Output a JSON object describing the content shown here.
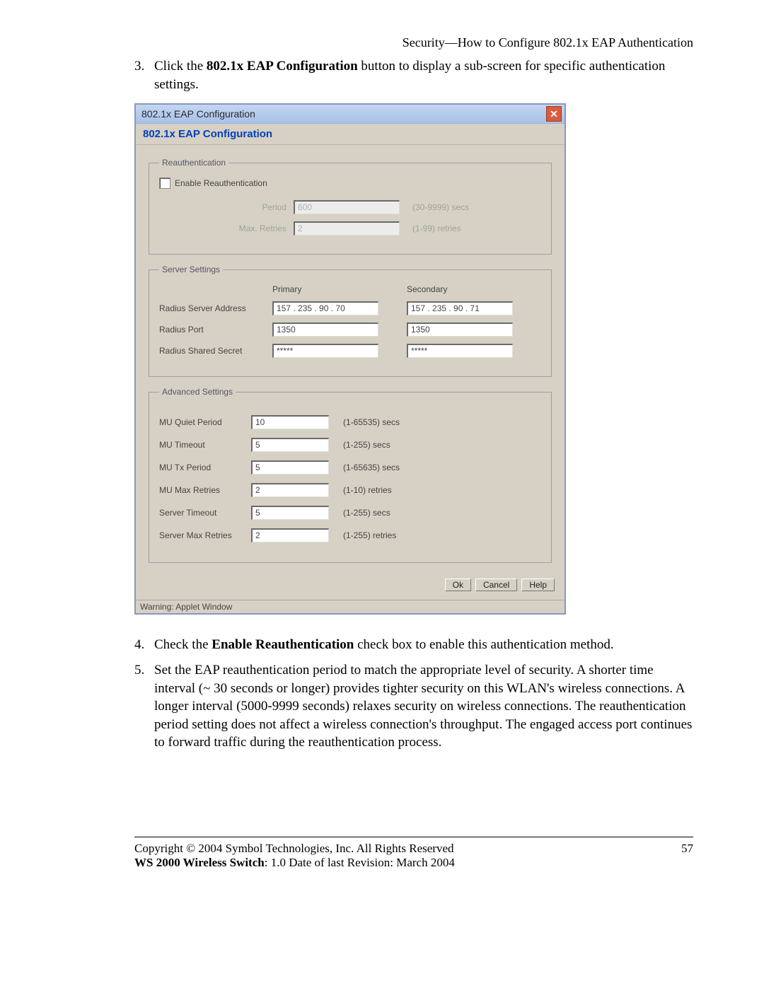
{
  "header": "Security—How to Configure 802.1x EAP Authentication",
  "steps": {
    "s3_num": "3.",
    "s3_a": "Click the ",
    "s3_bold": "802.1x EAP Configuration",
    "s3_b": " button to display a sub-screen for specific authentication settings.",
    "s4_num": "4.",
    "s4_a": "Check the ",
    "s4_bold": "Enable Reauthentication",
    "s4_b": " check box to enable this authentication method.",
    "s5_num": "5.",
    "s5": "Set the EAP reauthentication period to match the appropriate level of security. A shorter time interval (~ 30 seconds or longer) provides tighter security on this WLAN's wireless connections. A longer interval (5000-9999 seconds) relaxes security on wireless connections. The reauthentication period setting does not affect a wireless connection's throughput. The engaged access port continues to forward traffic during the reauthentication process."
  },
  "dialog": {
    "title": "802.1x EAP Configuration",
    "panel_title": "802.1x EAP Configuration",
    "close_glyph": "✕",
    "reauth": {
      "legend": "Reauthentication",
      "enable_label": "Enable Reauthentication",
      "period_label": "Period",
      "period_value": "600",
      "period_hint": "(30-9999) secs",
      "retries_label": "Max. Retries",
      "retries_value": "2",
      "retries_hint": "(1-99) retries"
    },
    "server": {
      "legend": "Server Settings",
      "primary_head": "Primary",
      "secondary_head": "Secondary",
      "addr_label": "Radius Server Address",
      "addr_primary": "157 . 235 . 90   . 70",
      "addr_secondary": "157 . 235 . 90   . 71",
      "port_label": "Radius Port",
      "port_primary": "1350",
      "port_secondary": "1350",
      "secret_label": "Radius Shared Secret",
      "secret_primary": "*****",
      "secret_secondary": "*****"
    },
    "advanced": {
      "legend": "Advanced Settings",
      "rows": [
        {
          "label": "MU Quiet Period",
          "value": "10",
          "hint": "(1-65535) secs"
        },
        {
          "label": "MU Timeout",
          "value": "5",
          "hint": "(1-255) secs"
        },
        {
          "label": "MU Tx Period",
          "value": "5",
          "hint": "(1-65635) secs"
        },
        {
          "label": "MU Max Retries",
          "value": "2",
          "hint": "(1-10) retries"
        },
        {
          "label": "Server Timeout",
          "value": "5",
          "hint": "(1-255) secs"
        },
        {
          "label": "Server Max Retries",
          "value": "2",
          "hint": "(1-255) retries"
        }
      ]
    },
    "buttons": {
      "ok": "Ok",
      "cancel": "Cancel",
      "help": "Help"
    },
    "statusbar": "Warning: Applet Window"
  },
  "footer": {
    "copyright": "Copyright © 2004 Symbol Technologies, Inc. All Rights Reserved",
    "product_bold": "WS 2000 Wireless Switch",
    "product_rest": ": 1.0  Date of last Revision: March 2004",
    "page": "57"
  }
}
